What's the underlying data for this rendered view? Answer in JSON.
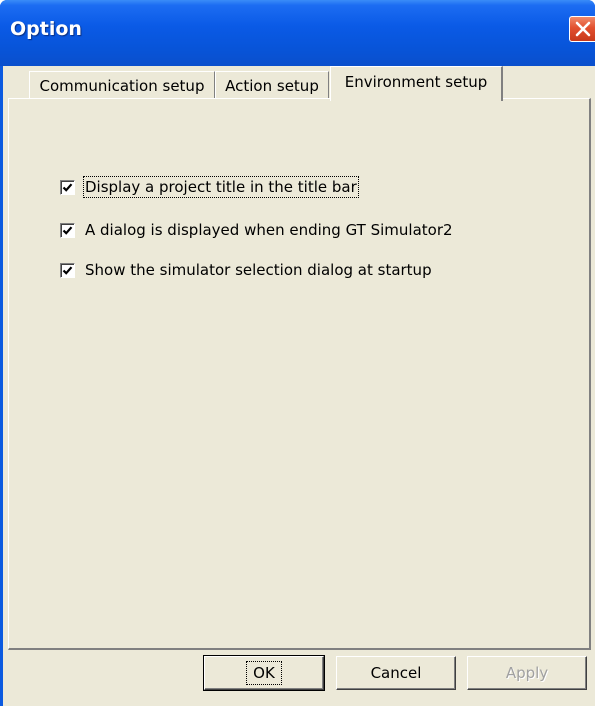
{
  "window": {
    "title": "Option"
  },
  "tabs": [
    {
      "label": "Communication setup",
      "selected": false
    },
    {
      "label": "Action setup",
      "selected": false
    },
    {
      "label": "Environment setup",
      "selected": true
    }
  ],
  "options": [
    {
      "label": "Display a project title in the title bar",
      "checked": true
    },
    {
      "label": "A dialog is displayed when ending GT Simulator2",
      "checked": true
    },
    {
      "label": "Show the simulator selection dialog at startup",
      "checked": true
    }
  ],
  "buttons": {
    "ok": "OK",
    "cancel": "Cancel",
    "apply": "Apply"
  },
  "colors": {
    "titlebar": "#0a5ae6",
    "client": "#ece9d8",
    "close_button": "#e2502f"
  }
}
